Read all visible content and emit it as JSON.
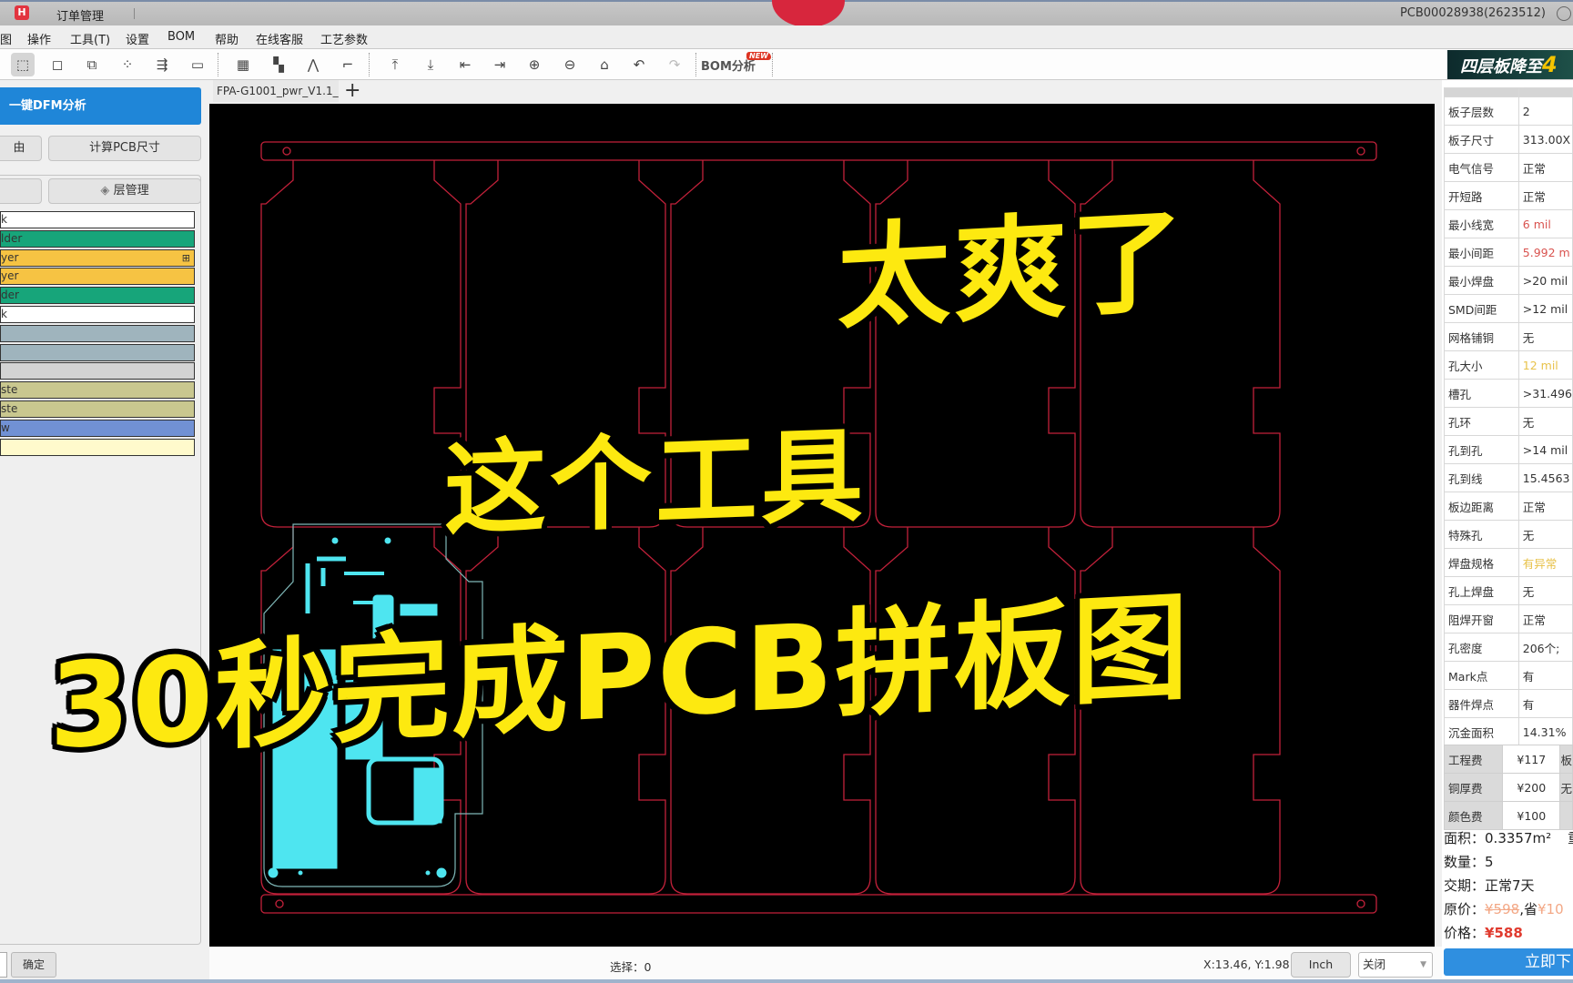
{
  "titlebar": {
    "logo": "H",
    "title": "订单管理",
    "order_id": "PCB00028938(2623512)"
  },
  "menu": [
    "图",
    "操作",
    "工具(T)",
    "设置",
    "BOM",
    "帮助",
    "在线客服",
    "工艺参数"
  ],
  "toolbar": {
    "tools": [
      {
        "name": "select-tool",
        "glyph": "⬚"
      },
      {
        "name": "box-select-tool",
        "glyph": "◻"
      },
      {
        "name": "shape-tool",
        "glyph": "⧉"
      },
      {
        "name": "node-tool",
        "glyph": "⁘"
      },
      {
        "name": "route-tool",
        "glyph": "⇶"
      },
      {
        "name": "ruler-tool",
        "glyph": "▭"
      },
      {
        "name": "panelize-tool",
        "glyph": "▦"
      },
      {
        "name": "mb-tool",
        "glyph": "▚"
      },
      {
        "name": "dfm-tool",
        "glyph": "⋀"
      },
      {
        "name": "ipc-tool",
        "glyph": "⌐"
      },
      {
        "name": "align-top-tool",
        "glyph": "⤒"
      },
      {
        "name": "align-bottom-tool",
        "glyph": "⤓"
      },
      {
        "name": "align-left-tool",
        "glyph": "⇤"
      },
      {
        "name": "align-right-tool",
        "glyph": "⇥"
      },
      {
        "name": "zoom-in-tool",
        "glyph": "⊕"
      },
      {
        "name": "zoom-out-tool",
        "glyph": "⊖"
      },
      {
        "name": "home-tool",
        "glyph": "⌂"
      },
      {
        "name": "undo-tool",
        "glyph": "↶"
      },
      {
        "name": "redo-tool",
        "glyph": "↷"
      }
    ],
    "bom_label": "BOM分析",
    "new_badge": "NEW",
    "promo": "四层板降至",
    "promo_highlight": "4"
  },
  "left_panel": {
    "dfm_button": "一键DFM分析",
    "left_btn_1": "由",
    "calc_pcb_button": "计算PCB尺寸",
    "left_btn_2": "",
    "layer_mgmt_button": "层管理",
    "layers": [
      {
        "label": "k",
        "color": "#ffffff"
      },
      {
        "label": "lder",
        "color": "#17a57a"
      },
      {
        "label": "yer",
        "color": "#f6c343",
        "icon": "⊞"
      },
      {
        "label": "yer",
        "color": "#f6c343"
      },
      {
        "label": "der",
        "color": "#17a57a"
      },
      {
        "label": "k",
        "color": "#ffffff"
      },
      {
        "label": "",
        "color": "#9fb4bd"
      },
      {
        "label": "",
        "color": "#9fb4bd"
      },
      {
        "label": "",
        "color": "#d3d3d3"
      },
      {
        "label": "ste",
        "color": "#c9c78f"
      },
      {
        "label": "ste",
        "color": "#c9c78f"
      },
      {
        "label": "w",
        "color": "#7191d4"
      },
      {
        "label": "",
        "color": "#fffacc"
      }
    ],
    "confirm_button": "确定"
  },
  "document": {
    "tab_label": "FPA-G1001_pwr_V1.1_...",
    "add_tab": "+"
  },
  "overlay": {
    "line1": "太爽了",
    "line2": "这个工具",
    "line3": "30秒完成PCB拼板图"
  },
  "properties": [
    {
      "key": "板子层数",
      "value": "2",
      "color": "#333333"
    },
    {
      "key": "板子尺寸",
      "value": "313.00X",
      "color": "#333333"
    },
    {
      "key": "电气信号",
      "value": "正常",
      "color": "#333333"
    },
    {
      "key": "开短路",
      "value": "正常",
      "color": "#333333"
    },
    {
      "key": "最小线宽",
      "value": "6 mil",
      "color": "#d9534f"
    },
    {
      "key": "最小间距",
      "value": "5.992 m",
      "color": "#d9534f"
    },
    {
      "key": "最小焊盘",
      "value": ">20 mil",
      "color": "#333333"
    },
    {
      "key": "SMD间距",
      "value": ">12 mil",
      "color": "#333333"
    },
    {
      "key": "网格铺铜",
      "value": "无",
      "color": "#333333"
    },
    {
      "key": "孔大小",
      "value": "12 mil",
      "color": "#e8c24a"
    },
    {
      "key": "槽孔",
      "value": ">31.496",
      "color": "#333333"
    },
    {
      "key": "孔环",
      "value": "无",
      "color": "#333333"
    },
    {
      "key": "孔到孔",
      "value": ">14 mil",
      "color": "#333333"
    },
    {
      "key": "孔到线",
      "value": "15.4563",
      "color": "#333333"
    },
    {
      "key": "板边距离",
      "value": "正常",
      "color": "#333333"
    },
    {
      "key": "特殊孔",
      "value": "无",
      "color": "#333333"
    },
    {
      "key": "焊盘规格",
      "value": "有异常",
      "color": "#e8c24a"
    },
    {
      "key": "孔上焊盘",
      "value": "无",
      "color": "#333333"
    },
    {
      "key": "阻焊开窗",
      "value": "正常",
      "color": "#333333"
    },
    {
      "key": "孔密度",
      "value": "206个;",
      "color": "#333333"
    },
    {
      "key": "Mark点",
      "value": "有",
      "color": "#333333"
    },
    {
      "key": "器件焊点",
      "value": "有",
      "color": "#333333"
    },
    {
      "key": "沉金面积",
      "value": "14.31%",
      "color": "#333333"
    }
  ],
  "fees": [
    {
      "key": "工程费",
      "value": "¥117",
      "extra": "板"
    },
    {
      "key": "铜厚费",
      "value": "¥200",
      "extra": "无"
    },
    {
      "key": "颜色费",
      "value": "¥100",
      "extra": ""
    }
  ],
  "summary": {
    "area_label": "面积：",
    "area_value": "0.3357m²",
    "area_extra": "重",
    "qty_label": "数量：",
    "qty_value": "5",
    "lead_label": "交期：",
    "lead_value": "正常7天",
    "orig_label": "原价：",
    "orig_value": "¥598",
    "save_text": ",省",
    "save_value": "¥10",
    "price_label": "价格：",
    "price_value": "¥588",
    "order_button": "立即下"
  },
  "statusbar": {
    "selection": "选择：0",
    "coords": "X:13.46, Y:1.98",
    "unit_button": "Inch",
    "select_value": "关闭"
  }
}
